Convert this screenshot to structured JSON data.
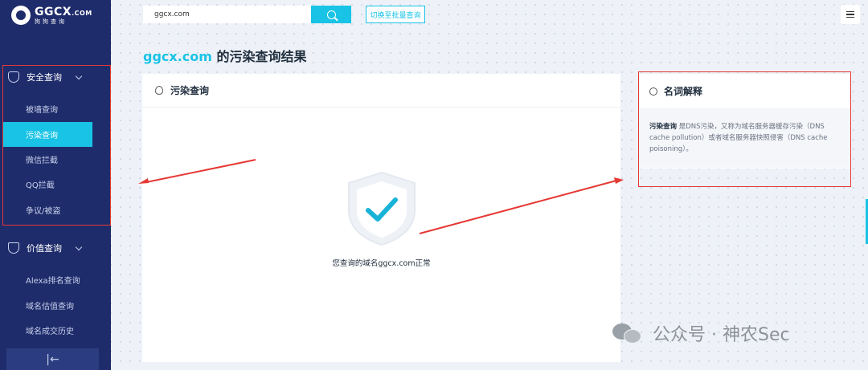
{
  "brand": {
    "logo_main": "GGCX",
    "logo_suffix": ".COM",
    "logo_sub": "狗狗查询"
  },
  "sidebar": {
    "groups": [
      {
        "label": "安全查询",
        "items": [
          "被墙查询",
          "污染查询",
          "微信拦截",
          "QQ拦截",
          "争议/被盗"
        ],
        "active": "污染查询"
      },
      {
        "label": "价值查询",
        "items": [
          "Alexa排名查询",
          "域名估值查询",
          "域名成交历史"
        ]
      }
    ],
    "collapse_icon": "|←"
  },
  "topbar": {
    "search_value": "ggcx.com",
    "batch_link": "切换至批量查询"
  },
  "page": {
    "title_domain": "ggcx.com",
    "title_rest": " 的污染查询结果"
  },
  "result_card": {
    "title": "污染查询",
    "message": "您查询的域名ggcx.com正常"
  },
  "glossary": {
    "title": "名词解释",
    "term": "污染查询",
    "definition": " 是DNS污染，又称为域名服务器缓存污染（DNS cache pollution）或者域名服务器快照侵害（DNS cache poisoning）。"
  },
  "watermark": "公众号 · 神农Sec",
  "colors": {
    "sidebar_bg": "#1e2c6b",
    "accent": "#19c3e6",
    "annotation_red": "#e53935",
    "success_check": "#19b3d8"
  }
}
